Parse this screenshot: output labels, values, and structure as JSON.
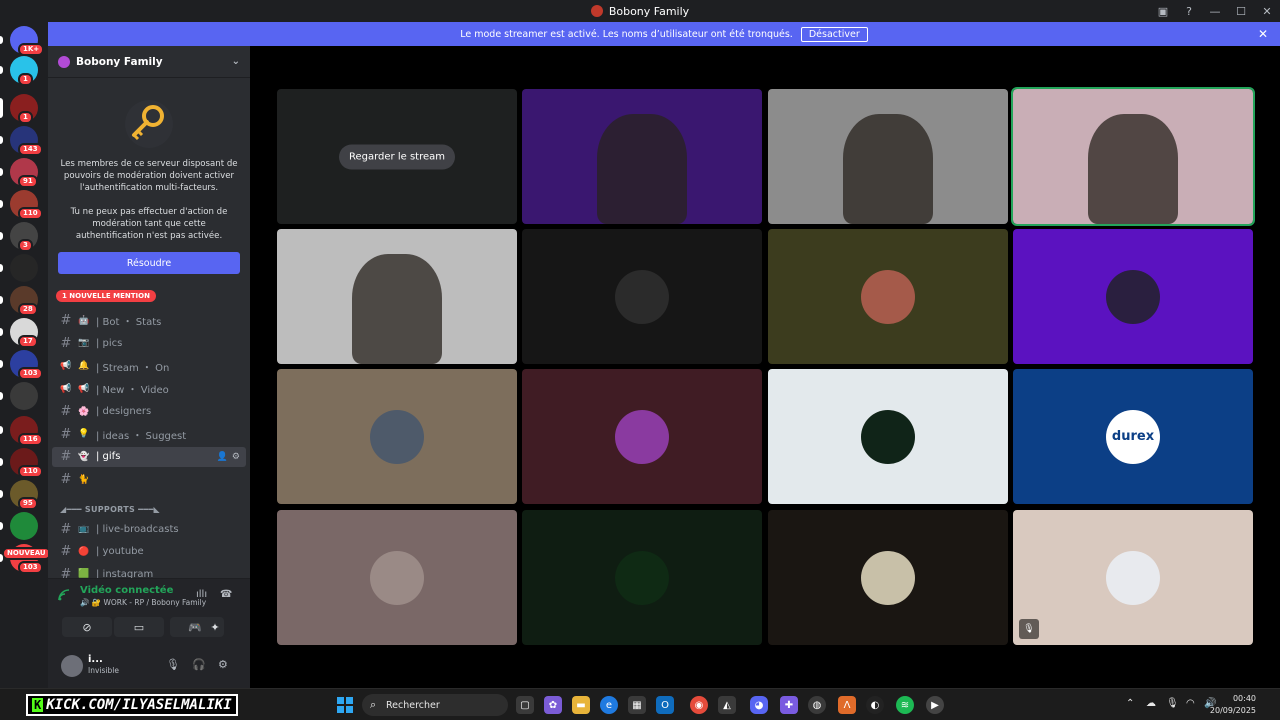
{
  "window": {
    "title": "Bobony Family"
  },
  "notice": {
    "text": "Le mode streamer est activé. Les noms d’utilisateur ont été tronqués.",
    "button": "Désactiver"
  },
  "guilds": [
    {
      "color": "#5865f2",
      "badge": "1K+"
    },
    {
      "color": "#29c2e9",
      "badge": "1"
    },
    {
      "color": "#8a1f1f",
      "badge": "1"
    },
    {
      "color": "#27347a",
      "badge": "143"
    },
    {
      "color": "#b0384a",
      "badge": "91"
    },
    {
      "color": "#9b3b2f",
      "badge": "110"
    },
    {
      "color": "#444444",
      "badge": "3"
    },
    {
      "color": "#262626",
      "badge": ""
    },
    {
      "color": "#5a3a2a",
      "badge": "28"
    },
    {
      "color": "#d9d9d9",
      "badge": "17"
    },
    {
      "color": "#2c3fa0",
      "badge": "103"
    },
    {
      "color": "#3a3a3a",
      "badge": ""
    },
    {
      "color": "#7a1d1d",
      "badge": "116"
    },
    {
      "color": "#6b1a1a",
      "badge": "110"
    },
    {
      "color": "#6b5a2a",
      "badge": "95"
    },
    {
      "color": "#1f8a3a",
      "badge": ""
    },
    {
      "color": "#f23f43",
      "badge": "103",
      "label": "NOUVEAU"
    }
  ],
  "sidebar": {
    "server_name": "Bobony Family",
    "mfa_text1": "Les membres de ce serveur disposant de pouvoirs de modération doivent activer l'authentification multi-facteurs.",
    "mfa_text2": "Tu ne peux pas effectuer d'action de modération tant que cette authentification n'est pas activée.",
    "resolve_button": "Résoudre",
    "mention_pill": "1 NOUVELLE MENTION",
    "channels": [
      {
        "type": "text",
        "emoji": "😍",
        "label": ""
      },
      {
        "type": "text",
        "emoji": "🤖",
        "label": "| Bot ・ Stats"
      },
      {
        "type": "text",
        "emoji": "📷",
        "label": "| pics"
      },
      {
        "type": "announce",
        "emoji": "🔔",
        "label": "| Stream ・ On"
      },
      {
        "type": "announce",
        "emoji": "📢",
        "label": "| New ・ Video"
      },
      {
        "type": "text",
        "emoji": "🌸",
        "label": "| designers"
      },
      {
        "type": "text",
        "emoji": "💡",
        "label": "| ideas ・ Suggest"
      },
      {
        "type": "text",
        "emoji": "👻",
        "label": "| gifs",
        "active": true
      },
      {
        "type": "text",
        "emoji": "🐈",
        "label": ""
      }
    ],
    "category": "◢━━━ SUPPORTS ━━━◣",
    "channels2": [
      {
        "type": "text",
        "emoji": "📺",
        "label": "| live-broadcasts"
      },
      {
        "type": "text",
        "emoji": "🔴",
        "label": "| youtube"
      },
      {
        "type": "text",
        "emoji": "🟩",
        "label": "| instagram"
      }
    ]
  },
  "voice": {
    "status": "Vidéo connectée",
    "channel": "🔊 🔐 WORK - RP / Bobony Family"
  },
  "user": {
    "name": "i...",
    "status": "Invisible"
  },
  "stage": {
    "watch_label": "Regarder le stream",
    "tiles": [
      {
        "kind": "stream",
        "bg": "#1e2020"
      },
      {
        "kind": "video",
        "bg": "#3a1770"
      },
      {
        "kind": "video",
        "bg": "#8c8c8c"
      },
      {
        "kind": "video",
        "bg": "#c9aeb6",
        "speaking": true
      },
      {
        "kind": "video",
        "bg": "#bdbdbd"
      },
      {
        "kind": "avatar",
        "bg": "#161616",
        "av": "#2b2b2b"
      },
      {
        "kind": "avatar",
        "bg": "#3c3c1e",
        "av": "#a55a4a"
      },
      {
        "kind": "avatar",
        "bg": "#5b12c0",
        "av": "#2a1f3f"
      },
      {
        "kind": "avatar",
        "bg": "#7d6e5c",
        "av": "#4e5a6a"
      },
      {
        "kind": "avatar",
        "bg": "#401c24",
        "av": "#8a3aa0"
      },
      {
        "kind": "avatar",
        "bg": "#e3e9ec",
        "av": "#102418"
      },
      {
        "kind": "avatar",
        "bg": "#0c3f86",
        "av": "#ffffff",
        "text": "durex"
      },
      {
        "kind": "avatar",
        "bg": "#7a6867",
        "av": "#9a8a86"
      },
      {
        "kind": "avatar",
        "bg": "#0f1d12",
        "av": "#0f2a14"
      },
      {
        "kind": "avatar",
        "bg": "#1a1612",
        "av": "#c8c0a8"
      },
      {
        "kind": "avatar",
        "bg": "#d9c9bf",
        "av": "#e8eaee",
        "muted": true
      }
    ]
  },
  "taskbar": {
    "kick": "KICK.COM/ILYASELMALIKI",
    "search": "Rechercher",
    "time": "00:40",
    "date": "20/09/2025"
  }
}
